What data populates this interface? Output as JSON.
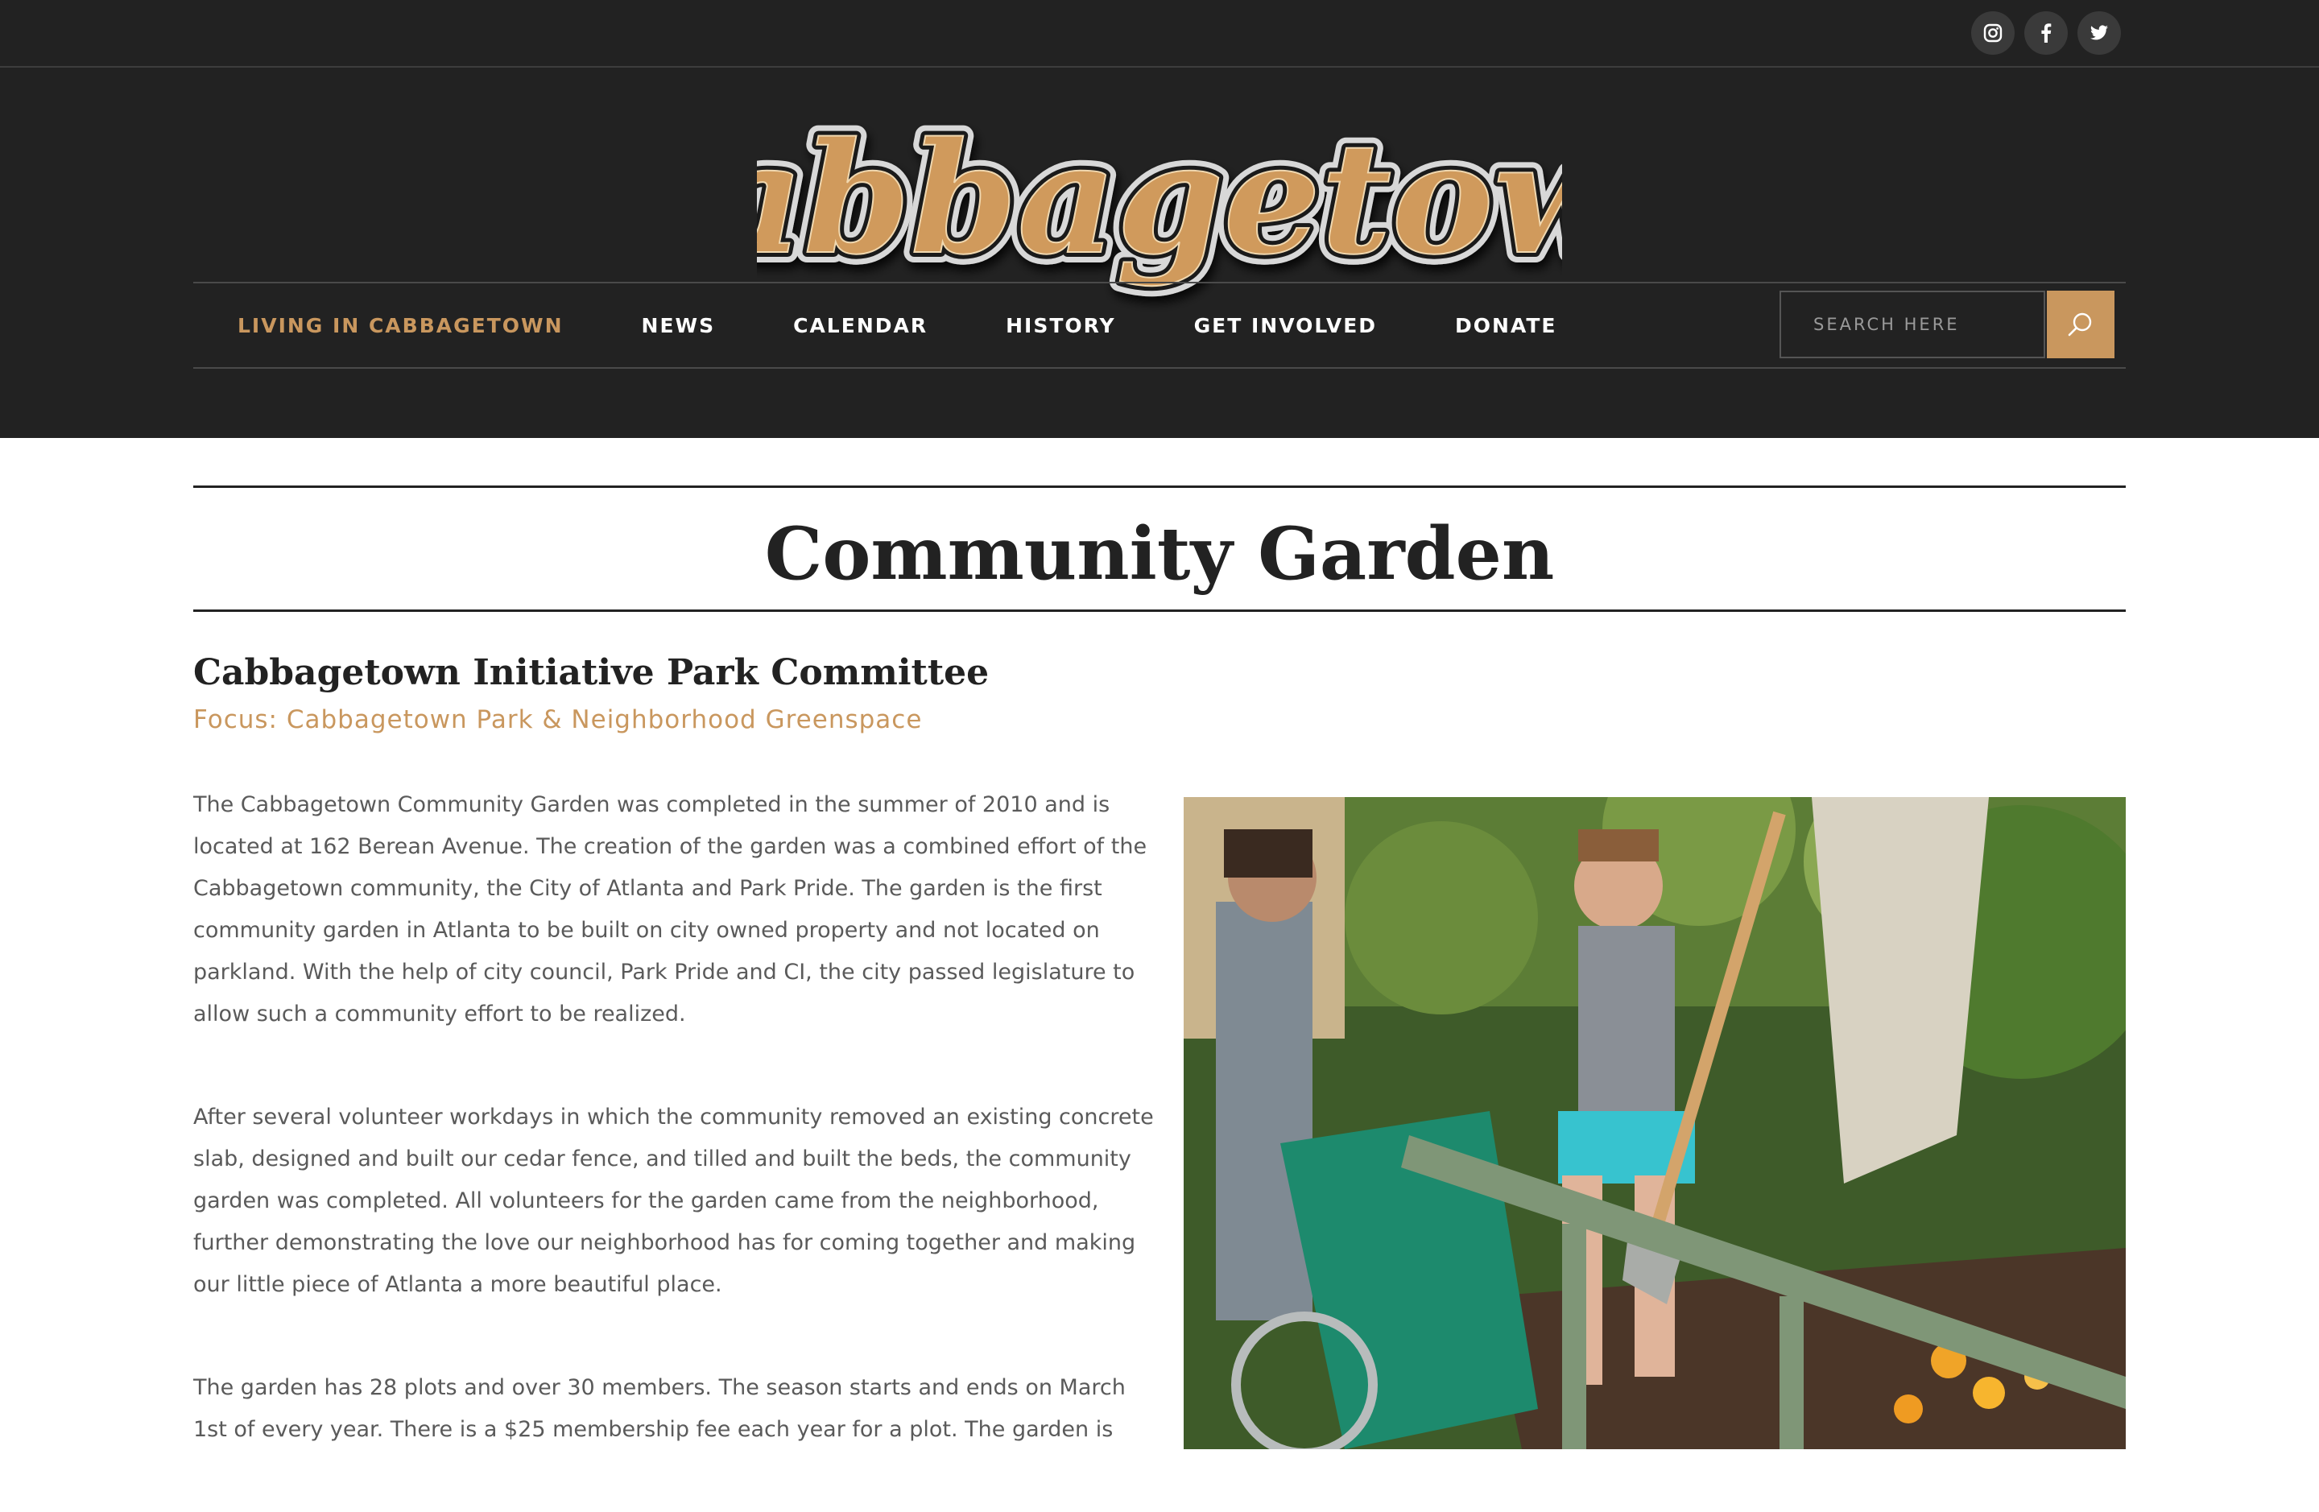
{
  "social": {
    "instagram": "instagram-icon",
    "facebook": "facebook-icon",
    "twitter": "twitter-icon"
  },
  "logo": {
    "text": "Cabbagetown"
  },
  "nav": {
    "items": [
      {
        "label": "LIVING IN CABBAGETOWN",
        "active": true
      },
      {
        "label": "NEWS"
      },
      {
        "label": "CALENDAR"
      },
      {
        "label": "HISTORY"
      },
      {
        "label": "GET INVOLVED"
      },
      {
        "label": "DONATE"
      }
    ],
    "search_placeholder": "SEARCH HERE",
    "search_icon": "search-icon"
  },
  "page": {
    "title": "Community Garden",
    "heading": "Cabbagetown Initiative Park Committee",
    "focus": "Focus: Cabbagetown Park & Neighborhood Greenspace",
    "paragraphs": [
      "The Cabbagetown Community Garden was completed in the summer of 2010 and is located at 162 Berean Avenue. The creation of the garden was a combined effort of the Cabbagetown community, the City of Atlanta and Park Pride. The garden is the first community garden in Atlanta to be built on city owned property and not located on parkland. With the help of city council, Park Pride and CI, the city passed  legislature to allow such a community effort to be realized.",
      "After several volunteer workdays in which the community removed an existing concrete slab, designed and built our cedar fence, and tilled and built the beds, the community garden was completed. All volunteers for the garden came from the neighborhood, further demonstrating the love our neighborhood has for coming together and making our little piece of Atlanta a more beautiful place.",
      "The garden has 28 plots and over 30 members. The season starts and ends on March 1st of every year. There is a $25 membership fee each year for a plot. The garden is"
    ]
  },
  "colors": {
    "header_bg": "#222222",
    "accent": "#c9975e",
    "text": "#5a5a5a",
    "heading": "#222222"
  }
}
